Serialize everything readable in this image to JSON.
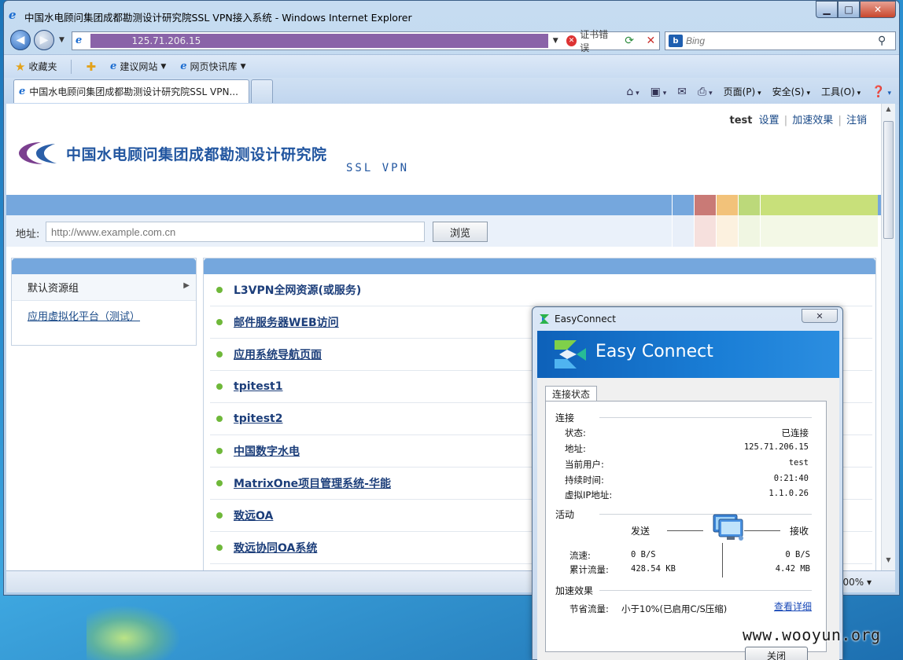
{
  "window": {
    "title": "中国水电顾问集团成都勘测设计研究院SSL VPN接入系统 - Windows Internet Explorer"
  },
  "address_bar": {
    "url": "125.71.206.15",
    "cert_error": "证书错误"
  },
  "search": {
    "placeholder": "Bing"
  },
  "favorites_bar": {
    "favorites": "收藏夹",
    "suggested_sites": "建议网站",
    "web_slice": "网页快讯库"
  },
  "tab": {
    "title": "中国水电顾问集团成都勘测设计研究院SSL VPN..."
  },
  "command_bar": {
    "page": "页面(P)",
    "safety": "安全(S)",
    "tools": "工具(O)"
  },
  "status_bar": {
    "zoom": "00%"
  },
  "page": {
    "user": "test",
    "links": {
      "settings": "设置",
      "acceleration": "加速效果",
      "logout": "注销"
    },
    "org_name": "中国水电顾问集团成都勘测设计研究院",
    "product": "SSL VPN",
    "address_label": "地址:",
    "address_placeholder": "http://www.example.com.cn",
    "browse_label": "浏览",
    "swatch_colors": [
      "#75a7dd",
      "#c97a76",
      "#f2c27a",
      "#bcd97a",
      "#c8e07a"
    ],
    "swatch_light_colors": [
      "#e8eff9",
      "#f6e0dd",
      "#fcf1df",
      "#f0f6e2",
      "#f3f8e6"
    ],
    "sidebar": {
      "group": "默认资源组",
      "link": "应用虚拟化平台（测试）"
    },
    "resources": [
      "L3VPN全网资源(或服务)",
      "邮件服务器WEB访问",
      "应用系统导航页面",
      "tpitest1",
      "tpitest2",
      "中国数字水电",
      "MatrixOne项目管理系统-华能",
      "致远OA",
      "致远协同OA系统"
    ]
  },
  "easyconnect": {
    "title": "EasyConnect",
    "brand": "Easy Connect",
    "tab": "连接状态",
    "connection_section": "连接",
    "status_label": "状态:",
    "status_value": "已连接",
    "address_label": "地址:",
    "address_value": "125.71.206.15",
    "user_label": "当前用户:",
    "user_value": "test",
    "duration_label": "持续时间:",
    "duration_value": "0:21:40",
    "vip_label": "虚拟IP地址:",
    "vip_value": "1.1.0.26",
    "activity_section": "活动",
    "send": "发送",
    "receive": "接收",
    "rate_label": "流速:",
    "send_rate": "0 B/S",
    "recv_rate": "0 B/S",
    "total_label": "累计流量:",
    "send_total": "428.54 KB",
    "recv_total": "4.42 MB",
    "accel_section": "加速效果",
    "saved_label": "节省流量:",
    "saved_value": "小于10%(已启用C/S压缩)",
    "detail_link": "查看详细",
    "close_button": "关闭"
  },
  "desktop": {
    "watermark": "www.wooyun.org"
  }
}
